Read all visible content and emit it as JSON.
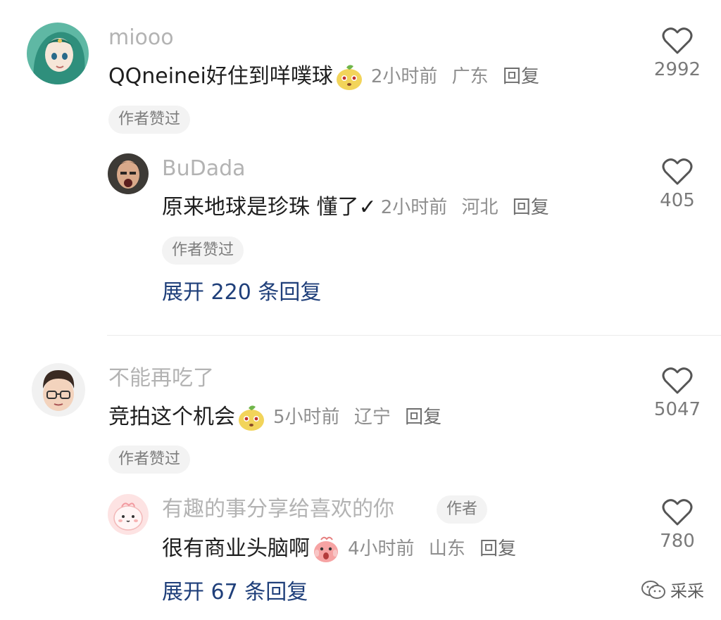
{
  "comments": [
    {
      "username": "miooo",
      "text": "QQneinei好住到咩噗球",
      "time": "2小时前",
      "location": "广东",
      "reply_label": "回复",
      "likes": "2992",
      "author_liked": "作者赞过",
      "emoji": "pear-face",
      "replies": [
        {
          "username": "BuDada",
          "text": "原来地球是珍珠 懂了✓",
          "time": "2小时前",
          "location": "河北",
          "reply_label": "回复",
          "likes": "405",
          "author_liked": "作者赞过"
        }
      ],
      "expand_label": "展开 220 条回复"
    },
    {
      "username": "不能再吃了",
      "text": "竞拍这个机会",
      "time": "5小时前",
      "location": "辽宁",
      "reply_label": "回复",
      "likes": "5047",
      "author_liked": "作者赞过",
      "emoji": "pear-face",
      "replies": [
        {
          "username": "有趣的事分享给喜欢的你",
          "author_tag": "作者",
          "text": "很有商业头脑啊",
          "time": "4小时前",
          "location": "山东",
          "reply_label": "回复",
          "likes": "780",
          "emoji": "scream-face"
        }
      ],
      "expand_label": "展开 67 条回复"
    }
  ],
  "watermark": "采采",
  "colors": {
    "username": "#b3b3b3",
    "body_text": "#1f1f1f",
    "meta": "#8e8e8e",
    "expand": "#1f3f7a",
    "badge_bg": "#f3f3f3"
  }
}
